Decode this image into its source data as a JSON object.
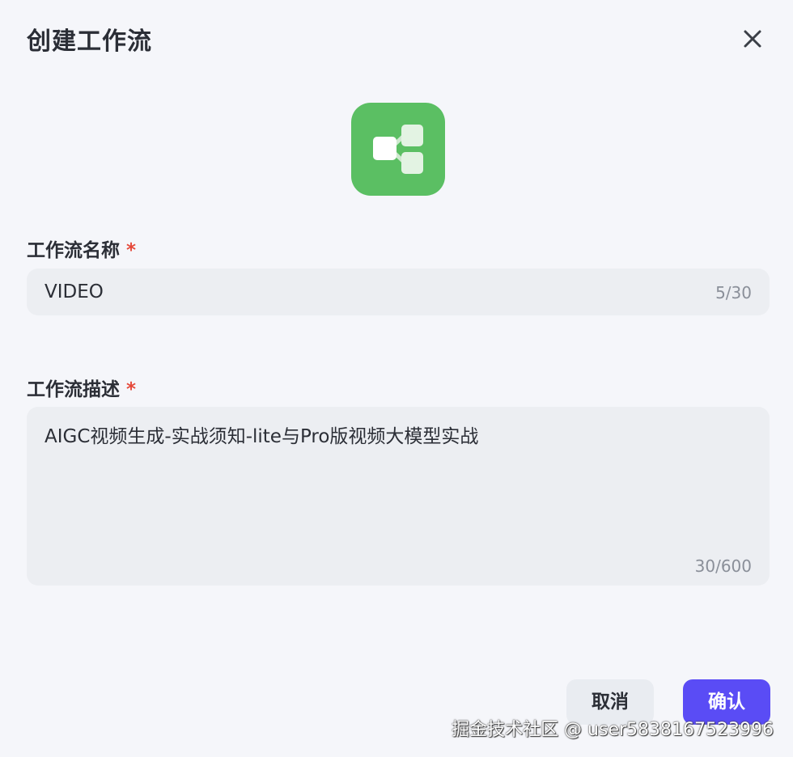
{
  "dialog": {
    "title": "创建工作流",
    "close_icon": "close-icon",
    "workflow_icon": "workflow-branch-icon",
    "icon_color": "#5bbf63"
  },
  "form": {
    "name": {
      "label": "工作流名称",
      "required_mark": "*",
      "value": "VIDEO",
      "counter": "5/30"
    },
    "description": {
      "label": "工作流描述",
      "required_mark": "*",
      "value": "AIGC视频生成-实战须知-lite与Pro版视频大模型实战",
      "counter": "30/600"
    }
  },
  "footer": {
    "cancel_label": "取消",
    "confirm_label": "确认",
    "confirm_color": "#5a4cf5"
  },
  "watermark": {
    "text": "掘金技术社区 @ user5838167523996"
  }
}
